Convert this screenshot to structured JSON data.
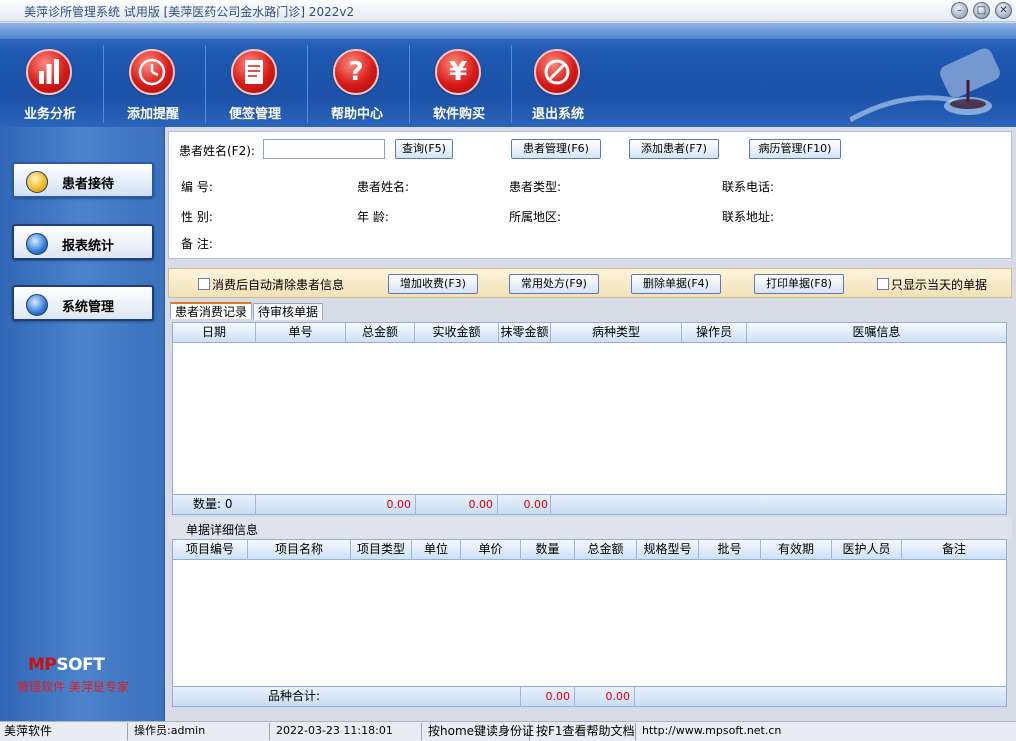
{
  "window": {
    "title": "美萍诊所管理系统 试用版 [美萍医药公司金水路门诊] 2022v2"
  },
  "toolbar": {
    "buttons": [
      {
        "label": "业务分析",
        "icon": "bar-chart-icon"
      },
      {
        "label": "添加提醒",
        "icon": "alarm-clock-icon"
      },
      {
        "label": "便签管理",
        "icon": "notepad-icon"
      },
      {
        "label": "帮助中心",
        "icon": "question-icon"
      },
      {
        "label": "软件购买",
        "icon": "yen-icon"
      },
      {
        "label": "退出系统",
        "icon": "prohibited-icon"
      }
    ]
  },
  "sidebar": {
    "items": [
      {
        "label": "患者接待",
        "active": true
      },
      {
        "label": "报表统计",
        "active": false
      },
      {
        "label": "系统管理",
        "active": false
      }
    ],
    "logo_brand": "SOFT",
    "slogan": "管理软件  美萍是专家"
  },
  "search": {
    "name_label": "患者姓名(F2):",
    "name_value": "",
    "query_btn": "查询(F5)",
    "manage_btn": "患者管理(F6)",
    "add_btn": "添加患者(F7)",
    "records_btn": "病历管理(F10)"
  },
  "patient": {
    "id_label": "编    号:",
    "name_label": "患者姓名:",
    "type_label": "患者类型:",
    "phone_label": "联系电话:",
    "gender_label": "性    别:",
    "age_label": "年    龄:",
    "region_label": "所属地区:",
    "address_label": "联系地址:",
    "note_label": "备    注:"
  },
  "actions": {
    "auto_clear_label": "消费后自动清除患者信息",
    "add_charge_btn": "增加收费(F3)",
    "common_rx_btn": "常用处方(F9)",
    "delete_btn": "删除单据(F4)",
    "print_btn": "打印单据(F8)",
    "today_only_label": "只显示当天的单据"
  },
  "tabs": [
    {
      "label": "患者消费记录",
      "active": true
    },
    {
      "label": "待审核单据",
      "active": false
    }
  ],
  "records_table": {
    "columns": [
      "日期",
      "单号",
      "总金额",
      "实收金额",
      "抹零金额",
      "病种类型",
      "操作员",
      "医嘱信息"
    ],
    "footer": {
      "count_label": "数量: 0",
      "total": "0.00",
      "received": "0.00",
      "rounding": "0.00"
    }
  },
  "detail": {
    "title": "单据详细信息",
    "columns": [
      "项目编号",
      "项目名称",
      "项目类型",
      "单位",
      "单价",
      "数量",
      "总金额",
      "规格型号",
      "批号",
      "有效期",
      "医护人员",
      "备注"
    ],
    "footer": {
      "sum_label": "品种合计:",
      "qty": "0.00",
      "amount": "0.00"
    }
  },
  "statusbar": {
    "company": "美萍软件",
    "operator": "操作员:admin",
    "datetime": "2022-03-23 11:18:01",
    "hint_id": "按home键读身份证",
    "hint_help": "按F1查看帮助文档",
    "url": "http://www.mpsoft.net.cn"
  },
  "colors": {
    "accent": "#1d58b2",
    "danger": "#d81b17",
    "amount": "#e00000"
  }
}
